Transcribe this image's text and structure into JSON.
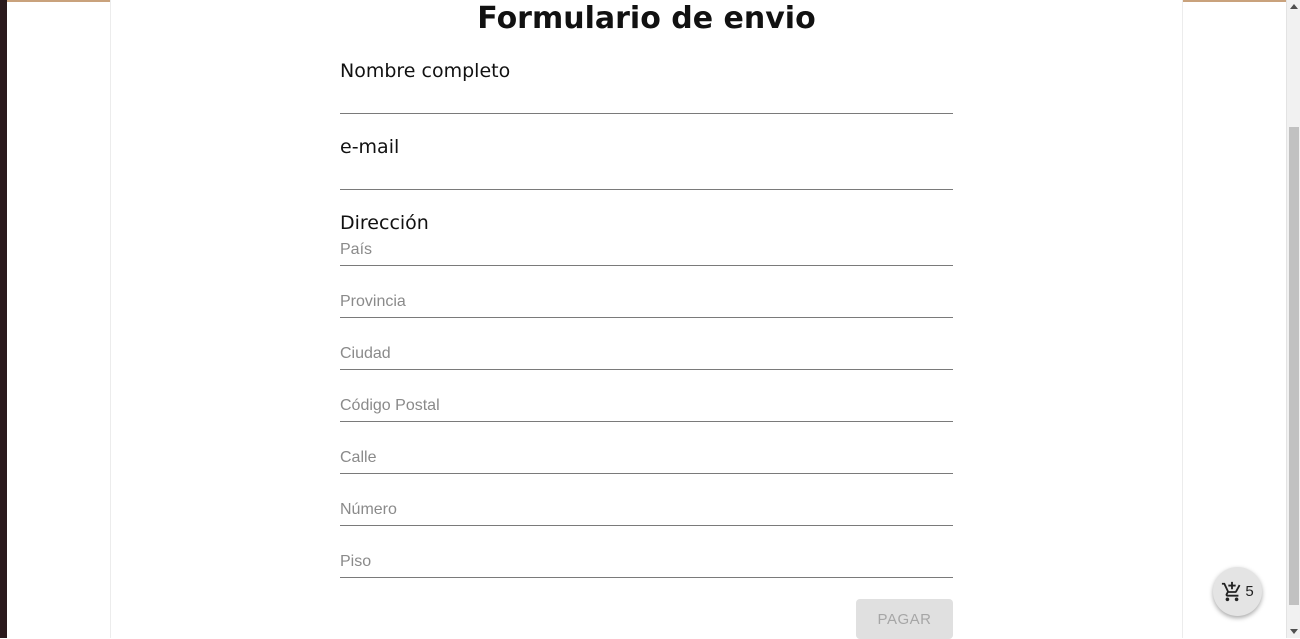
{
  "form": {
    "title": "Formulario de envio",
    "full_name": {
      "label": "Nombre completo",
      "value": ""
    },
    "email": {
      "label": "e-mail",
      "value": ""
    },
    "address": {
      "label": "Dirección",
      "fields": {
        "country": {
          "placeholder": "País"
        },
        "province": {
          "placeholder": "Provincia"
        },
        "city": {
          "placeholder": "Ciudad"
        },
        "postal_code": {
          "placeholder": "Código Postal"
        },
        "street": {
          "placeholder": "Calle"
        },
        "number": {
          "placeholder": "Número"
        },
        "floor": {
          "placeholder": "Piso"
        }
      }
    },
    "pay_label": "PAGAR"
  },
  "cart": {
    "icon": "add-shopping-cart-icon",
    "count": "5"
  },
  "colors": {
    "window_edge": "#2a1a1c",
    "top_accent": "#c9a27c",
    "button_disabled_bg": "#e0e0e0",
    "button_disabled_text": "#a6a6a6"
  }
}
